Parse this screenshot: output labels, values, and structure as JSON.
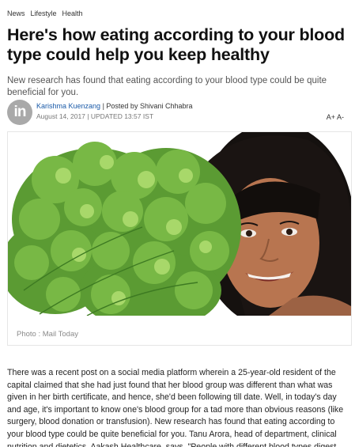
{
  "breadcrumb": {
    "items": [
      "News",
      "Lifestyle",
      "Health"
    ]
  },
  "article": {
    "headline": "Here's how eating according to your blood type could help you keep healthy",
    "subhead": "New research has found that eating according to your blood type could be quite beneficial for you.",
    "logo_text": "in",
    "author": "Karishma Kuenzang",
    "posted_by": "| Posted by Shivani Chhabra",
    "dateline": "August 14, 2017 | UPDATED 13:57 IST",
    "font_increase": "A+",
    "font_decrease": "A-",
    "photo_credit": "Photo : Mail Today",
    "body": "There was a recent post on a social media platform wherein a 25-year-old resident of the capital claimed that she had just found that her blood group was different than what was given in her birth certificate, and hence, she'd been following till date. Well, in today's day and age, it's important to know one's blood group for a tad more than obvious reasons (like surgery, blood donation or transfusion). New research has found that eating according to your blood type could be quite beneficial for you. Tanu Arora, head of department, clinical nutrition and dietetics, Aakash Healthcare, says, \"People with different blood types digest"
  },
  "colors": {
    "link": "#1a5aa8",
    "logo_bg": "#a9a9a9"
  },
  "icons": {
    "logo": "publication-logo-icon"
  }
}
